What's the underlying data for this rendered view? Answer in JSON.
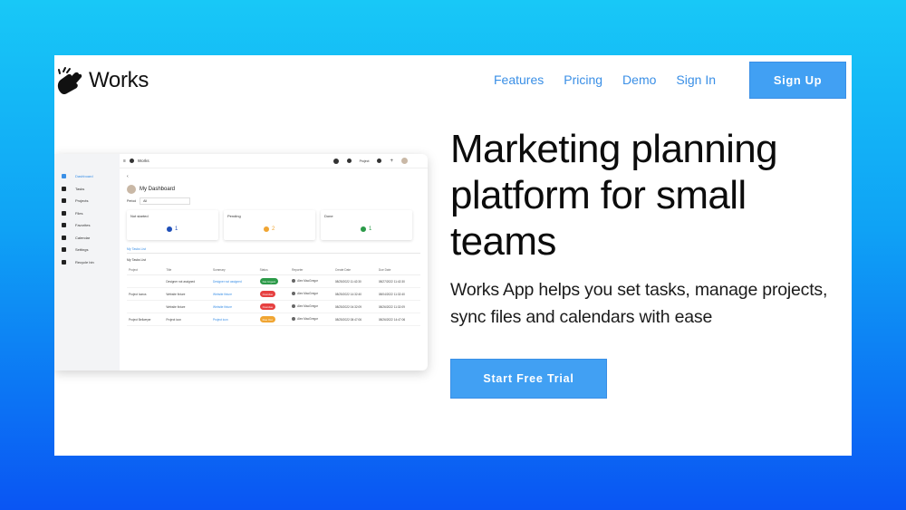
{
  "brand": {
    "name": "Works"
  },
  "nav": [
    {
      "label": "Features"
    },
    {
      "label": "Pricing"
    },
    {
      "label": "Demo"
    },
    {
      "label": "Sign In"
    }
  ],
  "signup_label": "Sign Up",
  "hero": {
    "title": "Marketing planning platform for small teams",
    "subtitle": "Works App helps you set tasks, manage projects, sync files and calendars with ease",
    "cta": "Start Free Trial"
  },
  "mock": {
    "brand": "Works",
    "project_select": "Project",
    "sidebar": [
      {
        "label": "Dashboard",
        "active": true
      },
      {
        "label": "Tasks"
      },
      {
        "label": "Projects"
      },
      {
        "label": "Files"
      },
      {
        "label": "Favorites"
      },
      {
        "label": "Calendar"
      },
      {
        "label": "Settings"
      },
      {
        "label": "Recycle bin"
      }
    ],
    "title": "My Dashboard",
    "period_label": "Period",
    "period_value": "All",
    "cards": [
      {
        "title": "Not started",
        "value": "1",
        "color": "#1f4fb8"
      },
      {
        "title": "Pending",
        "value": "2",
        "color": "#f0a532"
      },
      {
        "title": "Done",
        "value": "1",
        "color": "#2b9a48"
      }
    ],
    "tab": "My Tasks List",
    "table_title": "My Tasks List",
    "columns": [
      "Project",
      "Title",
      "Summary",
      "Status",
      "Reporter",
      "Create Date",
      "Due Date"
    ],
    "rows": [
      {
        "project": "",
        "title": "Designer not assigned",
        "summary": "Designer not assigned",
        "status": "Not Urgent",
        "status_color": "#2b9a48",
        "reporter": "Alex MacGregor",
        "create": "08/25/2022 11:42:30",
        "due": "08/27/2022 11:42:30"
      },
      {
        "project": "Project Icarus",
        "title": "Website fixture",
        "summary": "Website fixture",
        "status": "Overdue",
        "status_color": "#e64040",
        "reporter": "Alex MacGregor",
        "create": "08/25/2022 14:32:40",
        "due": "08/04/2022 11:32:40"
      },
      {
        "project": "",
        "title": "Website fixture",
        "summary": "Website fixture",
        "status": "Overdue",
        "status_color": "#e64040",
        "reporter": "Alex MacGregor",
        "create": "08/25/2022 04:32:09",
        "due": "08/26/2022 11:32:09"
      },
      {
        "project": "Project Bellweyer",
        "title": "Project icon",
        "summary": "Project icon",
        "status": "Due Out",
        "status_color": "#f0a532",
        "reporter": "Alex MacGregor",
        "create": "08/25/2022 08:47:06",
        "due": "08/26/2022 14:47:06"
      }
    ]
  }
}
